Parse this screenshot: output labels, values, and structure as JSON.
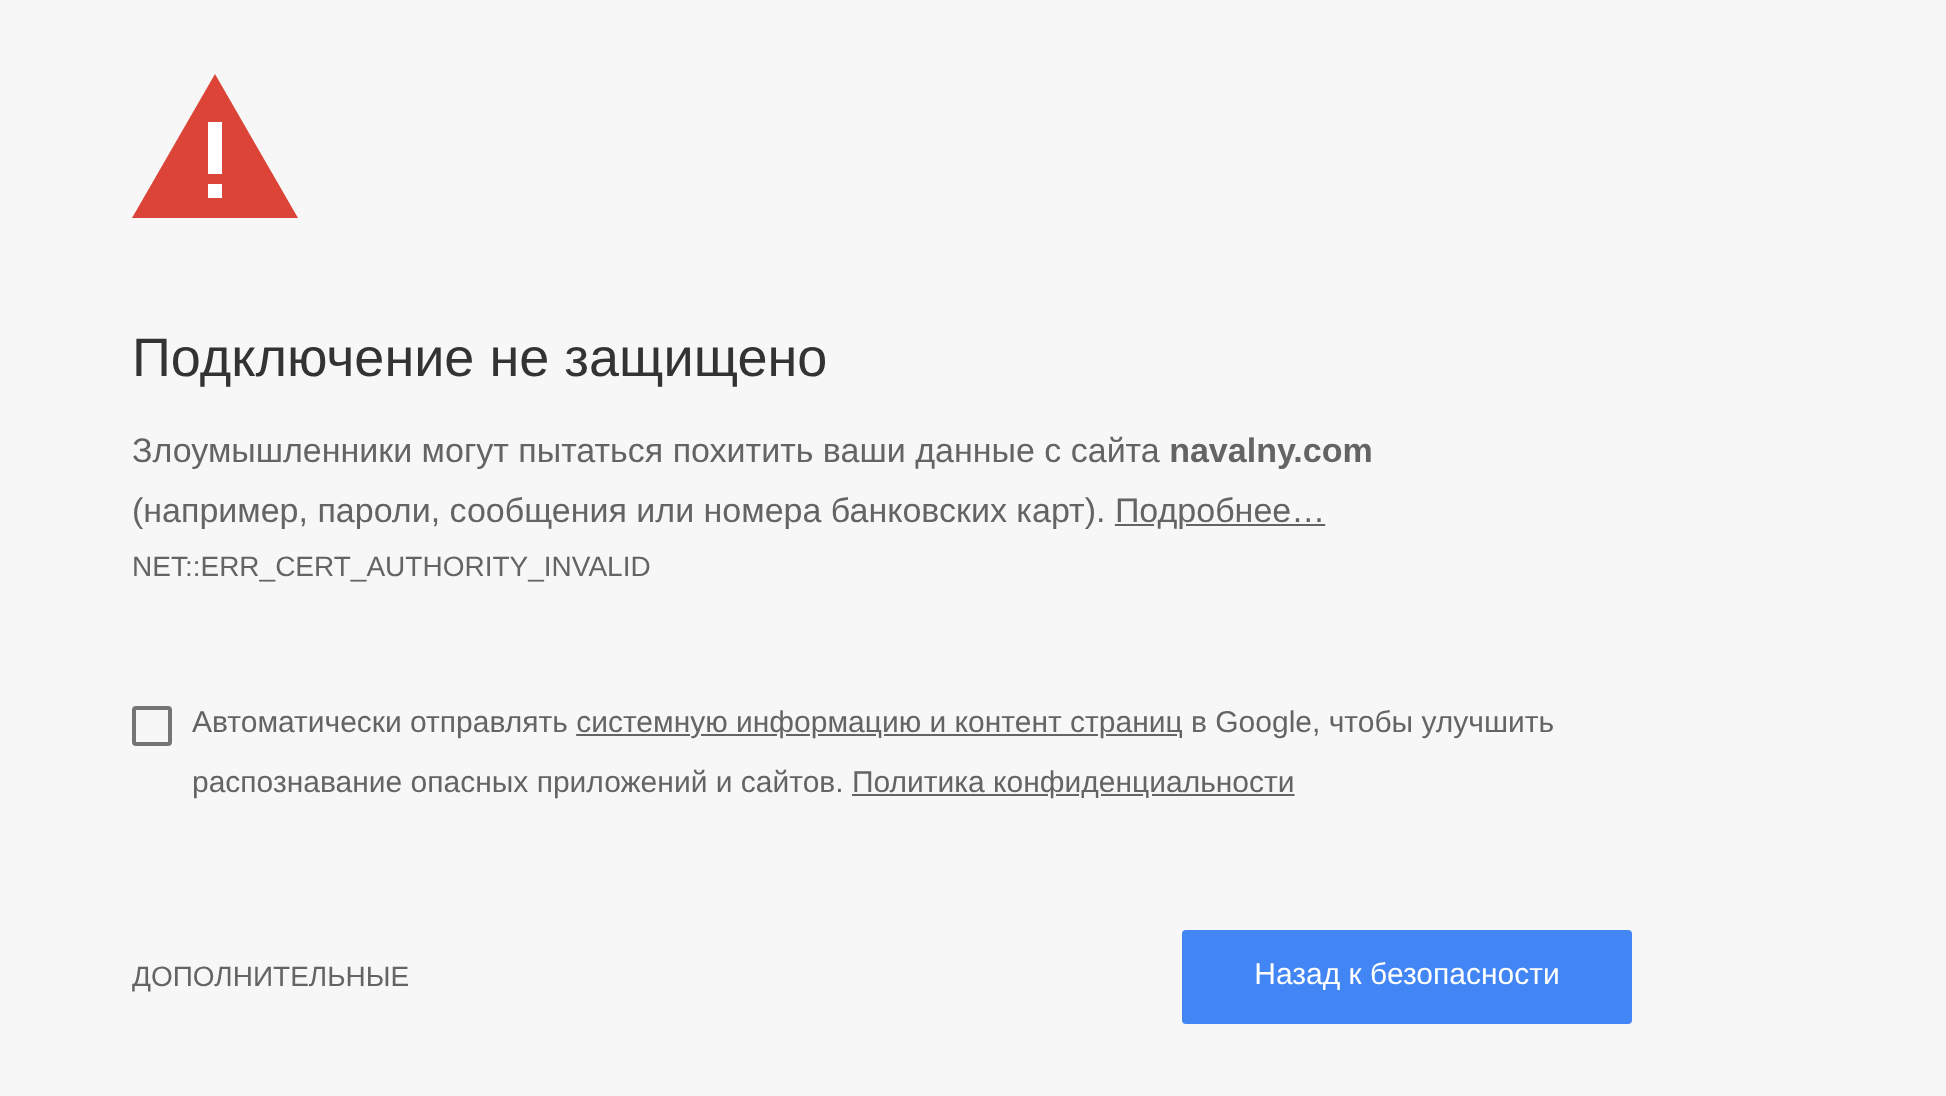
{
  "heading": "Подключение не защищено",
  "description": "Злоумышленники могут пытаться похитить ваши данные с сайта **navalny.com** (например, пароли, сообщения или номера банковских карт).",
  "details_link": "Подробнее…",
  "error_code": "NET::ERR_CERT_AUTHORITY_INVALID",
  "report": {
    "checked": false,
    "text_1": "Автоматически отправлять",
    "link_1": "системную информацию и контент страниц",
    "text_2": "в Google, чтобы улучшить распознавание опасных приложений и сайтов.",
    "link_2": "Политика конфиденциальности"
  },
  "advanced_button": "ДОПОЛНИТЕЛЬНЫЕ",
  "back_button": "Назад к безопасности"
}
